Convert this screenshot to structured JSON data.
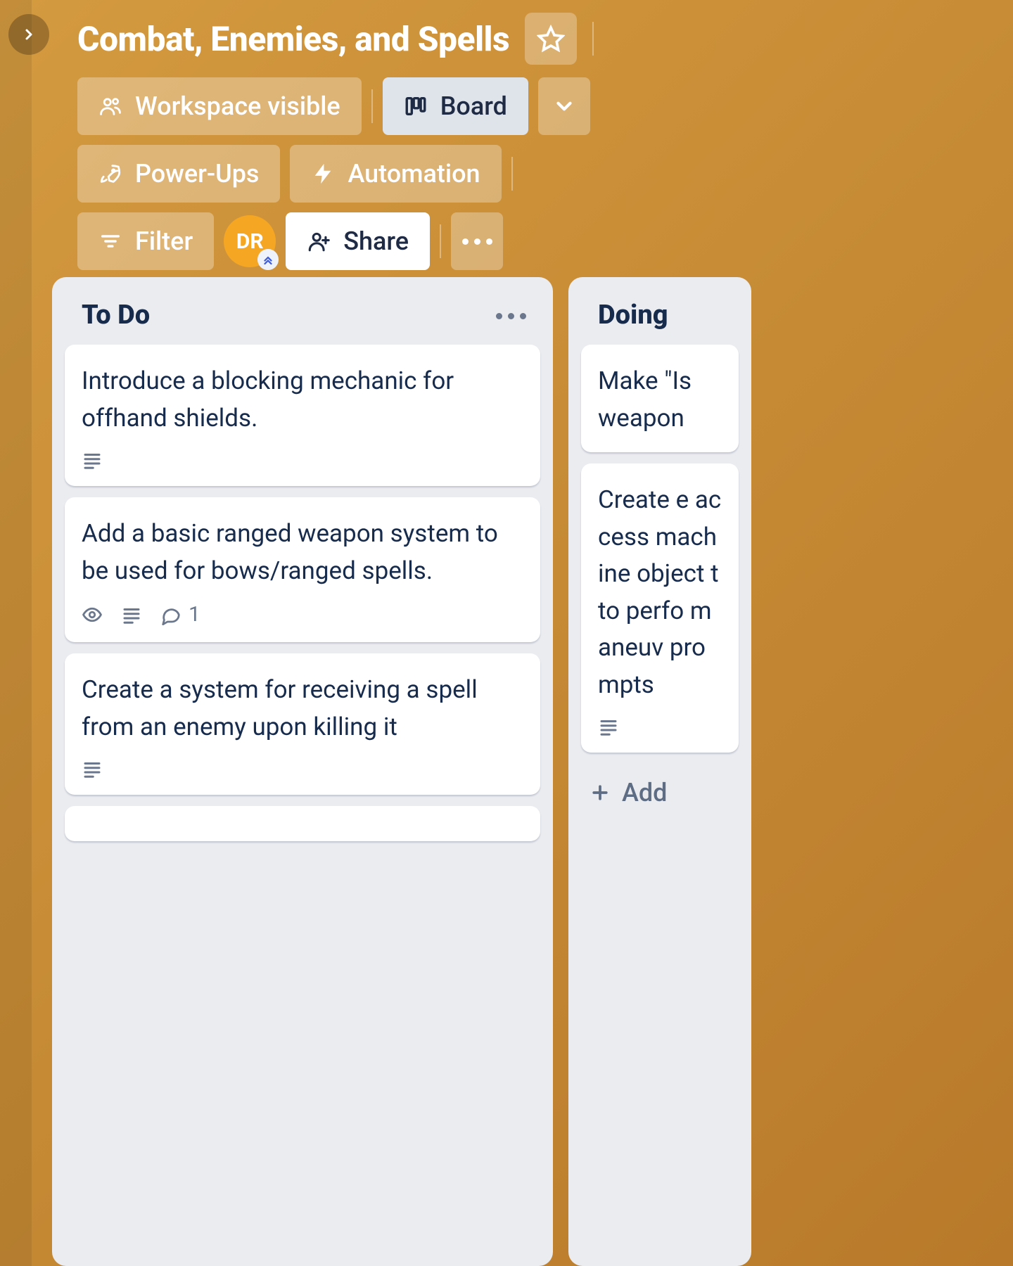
{
  "header": {
    "title": "Combat, Enemies, and Spells",
    "visibility_label": "Workspace visible",
    "view_label": "Board",
    "powerups_label": "Power-Ups",
    "automation_label": "Automation",
    "filter_label": "Filter",
    "share_label": "Share",
    "avatar_initials": "DR"
  },
  "lists": [
    {
      "title": "To Do",
      "cards": [
        {
          "title": "Introduce a blocking mechanic for offhand shields.",
          "has_description": true,
          "watching": false,
          "comments": 0
        },
        {
          "title": "Add a basic ranged weapon system to be used for bows/ranged spells.",
          "has_description": true,
          "watching": true,
          "comments": 1
        },
        {
          "title": "Create a system for receiving a spell from an enemy upon killing it",
          "has_description": true,
          "watching": false,
          "comments": 0
        }
      ]
    },
    {
      "title": "Doing",
      "cards": [
        {
          "title": "Make \"Is weapon",
          "has_description": false,
          "watching": false,
          "comments": 0
        },
        {
          "title": "Create e access machine object t to perfo maneuv prompts",
          "has_description": true,
          "watching": false,
          "comments": 0
        }
      ],
      "add_label": "Add"
    }
  ],
  "icons": {
    "chevron_right": "chevron-right-icon",
    "star": "star-icon",
    "people": "people-icon",
    "board": "board-icon",
    "chevron_down": "chevron-down-icon",
    "rocket": "rocket-icon",
    "bolt": "bolt-icon",
    "filter": "filter-icon",
    "person_add": "person-add-icon",
    "more": "more-icon",
    "description": "description-icon",
    "eye": "eye-icon",
    "comment": "comment-icon",
    "plus": "plus-icon"
  }
}
